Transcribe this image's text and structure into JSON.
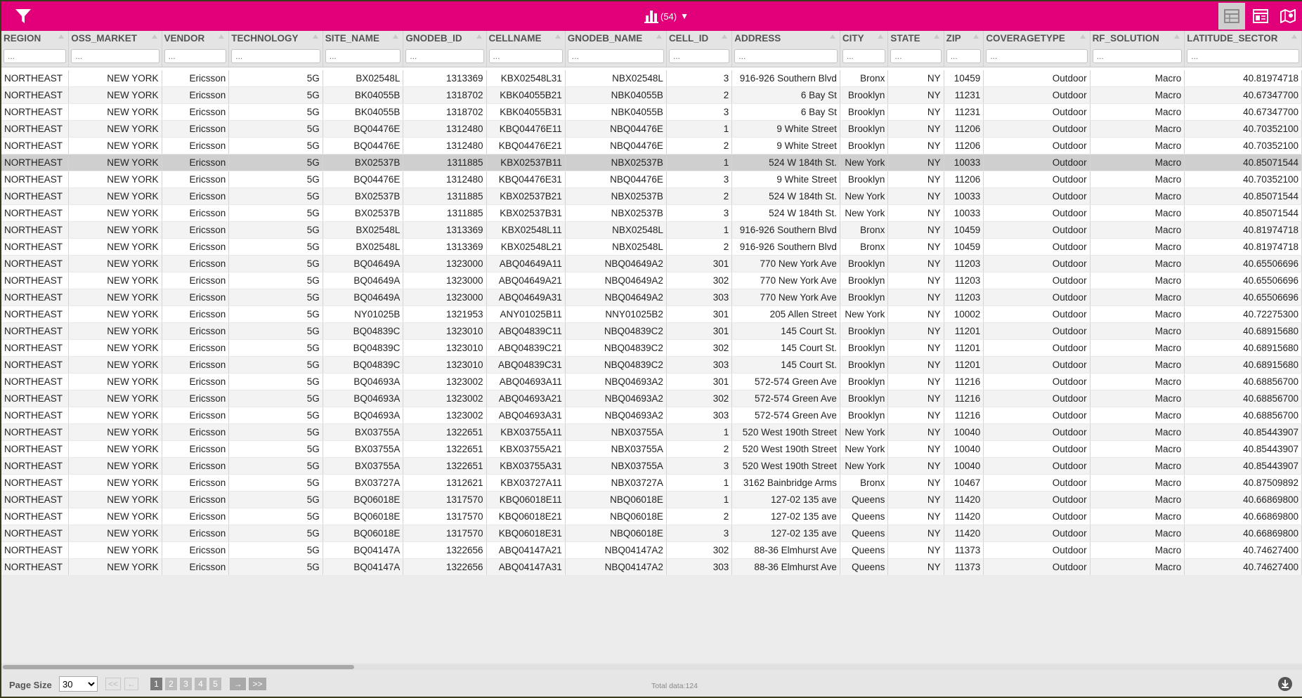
{
  "toolbar": {
    "chart_count": "(54)",
    "chart_caret": "▼",
    "colors": {
      "brand": "#e2007a",
      "active_view": "#cfcfcf"
    },
    "icons": [
      "filter-icon",
      "bar-chart-icon",
      "grid-view-icon",
      "report-view-icon",
      "map-view-icon"
    ]
  },
  "columns": [
    {
      "label": "REGION"
    },
    {
      "label": "OSS_MARKET"
    },
    {
      "label": "VENDOR"
    },
    {
      "label": "TECHNOLOGY"
    },
    {
      "label": "SITE_NAME"
    },
    {
      "label": "GNODEB_ID"
    },
    {
      "label": "CELLNAME"
    },
    {
      "label": "GNODEB_NAME"
    },
    {
      "label": "CELL_ID"
    },
    {
      "label": "ADDRESS"
    },
    {
      "label": "CITY"
    },
    {
      "label": "STATE"
    },
    {
      "label": "ZIP"
    },
    {
      "label": "COVERAGETYPE"
    },
    {
      "label": "RF_SOLUTION"
    },
    {
      "label": "LATITUDE_SECTOR"
    }
  ],
  "filter_placeholder": "...",
  "selected_row": 5,
  "rows": [
    [
      "NORTHEAST",
      "NEW YORK",
      "Ericsson",
      "5G",
      "BX02548L",
      "1313369",
      "KBX02548L31",
      "NBX02548L",
      "3",
      "916-926 Southern Blvd",
      "Bronx",
      "NY",
      "10459",
      "Outdoor",
      "Macro",
      "40.81974718"
    ],
    [
      "NORTHEAST",
      "NEW YORK",
      "Ericsson",
      "5G",
      "BK04055B",
      "1318702",
      "KBK04055B21",
      "NBK04055B",
      "2",
      "6 Bay St",
      "Brooklyn",
      "NY",
      "11231",
      "Outdoor",
      "Macro",
      "40.67347700"
    ],
    [
      "NORTHEAST",
      "NEW YORK",
      "Ericsson",
      "5G",
      "BK04055B",
      "1318702",
      "KBK04055B31",
      "NBK04055B",
      "3",
      "6 Bay St",
      "Brooklyn",
      "NY",
      "11231",
      "Outdoor",
      "Macro",
      "40.67347700"
    ],
    [
      "NORTHEAST",
      "NEW YORK",
      "Ericsson",
      "5G",
      "BQ04476E",
      "1312480",
      "KBQ04476E11",
      "NBQ04476E",
      "1",
      "9 White Street",
      "Brooklyn",
      "NY",
      "11206",
      "Outdoor",
      "Macro",
      "40.70352100"
    ],
    [
      "NORTHEAST",
      "NEW YORK",
      "Ericsson",
      "5G",
      "BQ04476E",
      "1312480",
      "KBQ04476E21",
      "NBQ04476E",
      "2",
      "9 White Street",
      "Brooklyn",
      "NY",
      "11206",
      "Outdoor",
      "Macro",
      "40.70352100"
    ],
    [
      "NORTHEAST",
      "NEW YORK",
      "Ericsson",
      "5G",
      "BX02537B",
      "1311885",
      "KBX02537B11",
      "NBX02537B",
      "1",
      "524 W 184th St.",
      "New York",
      "NY",
      "10033",
      "Outdoor",
      "Macro",
      "40.85071544"
    ],
    [
      "NORTHEAST",
      "NEW YORK",
      "Ericsson",
      "5G",
      "BQ04476E",
      "1312480",
      "KBQ04476E31",
      "NBQ04476E",
      "3",
      "9 White Street",
      "Brooklyn",
      "NY",
      "11206",
      "Outdoor",
      "Macro",
      "40.70352100"
    ],
    [
      "NORTHEAST",
      "NEW YORK",
      "Ericsson",
      "5G",
      "BX02537B",
      "1311885",
      "KBX02537B21",
      "NBX02537B",
      "2",
      "524 W 184th St.",
      "New York",
      "NY",
      "10033",
      "Outdoor",
      "Macro",
      "40.85071544"
    ],
    [
      "NORTHEAST",
      "NEW YORK",
      "Ericsson",
      "5G",
      "BX02537B",
      "1311885",
      "KBX02537B31",
      "NBX02537B",
      "3",
      "524 W 184th St.",
      "New York",
      "NY",
      "10033",
      "Outdoor",
      "Macro",
      "40.85071544"
    ],
    [
      "NORTHEAST",
      "NEW YORK",
      "Ericsson",
      "5G",
      "BX02548L",
      "1313369",
      "KBX02548L11",
      "NBX02548L",
      "1",
      "916-926 Southern Blvd",
      "Bronx",
      "NY",
      "10459",
      "Outdoor",
      "Macro",
      "40.81974718"
    ],
    [
      "NORTHEAST",
      "NEW YORK",
      "Ericsson",
      "5G",
      "BX02548L",
      "1313369",
      "KBX02548L21",
      "NBX02548L",
      "2",
      "916-926 Southern Blvd",
      "Bronx",
      "NY",
      "10459",
      "Outdoor",
      "Macro",
      "40.81974718"
    ],
    [
      "NORTHEAST",
      "NEW YORK",
      "Ericsson",
      "5G",
      "BQ04649A",
      "1323000",
      "ABQ04649A11",
      "NBQ04649A2",
      "301",
      "770 New York Ave",
      "Brooklyn",
      "NY",
      "11203",
      "Outdoor",
      "Macro",
      "40.65506696"
    ],
    [
      "NORTHEAST",
      "NEW YORK",
      "Ericsson",
      "5G",
      "BQ04649A",
      "1323000",
      "ABQ04649A21",
      "NBQ04649A2",
      "302",
      "770 New York Ave",
      "Brooklyn",
      "NY",
      "11203",
      "Outdoor",
      "Macro",
      "40.65506696"
    ],
    [
      "NORTHEAST",
      "NEW YORK",
      "Ericsson",
      "5G",
      "BQ04649A",
      "1323000",
      "ABQ04649A31",
      "NBQ04649A2",
      "303",
      "770 New York Ave",
      "Brooklyn",
      "NY",
      "11203",
      "Outdoor",
      "Macro",
      "40.65506696"
    ],
    [
      "NORTHEAST",
      "NEW YORK",
      "Ericsson",
      "5G",
      "NY01025B",
      "1321953",
      "ANY01025B11",
      "NNY01025B2",
      "301",
      "205 Allen Street",
      "New York",
      "NY",
      "10002",
      "Outdoor",
      "Macro",
      "40.72275300"
    ],
    [
      "NORTHEAST",
      "NEW YORK",
      "Ericsson",
      "5G",
      "BQ04839C",
      "1323010",
      "ABQ04839C11",
      "NBQ04839C2",
      "301",
      "145 Court St.",
      "Brooklyn",
      "NY",
      "11201",
      "Outdoor",
      "Macro",
      "40.68915680"
    ],
    [
      "NORTHEAST",
      "NEW YORK",
      "Ericsson",
      "5G",
      "BQ04839C",
      "1323010",
      "ABQ04839C21",
      "NBQ04839C2",
      "302",
      "145 Court St.",
      "Brooklyn",
      "NY",
      "11201",
      "Outdoor",
      "Macro",
      "40.68915680"
    ],
    [
      "NORTHEAST",
      "NEW YORK",
      "Ericsson",
      "5G",
      "BQ04839C",
      "1323010",
      "ABQ04839C31",
      "NBQ04839C2",
      "303",
      "145 Court St.",
      "Brooklyn",
      "NY",
      "11201",
      "Outdoor",
      "Macro",
      "40.68915680"
    ],
    [
      "NORTHEAST",
      "NEW YORK",
      "Ericsson",
      "5G",
      "BQ04693A",
      "1323002",
      "ABQ04693A11",
      "NBQ04693A2",
      "301",
      "572-574 Green Ave",
      "Brooklyn",
      "NY",
      "11216",
      "Outdoor",
      "Macro",
      "40.68856700"
    ],
    [
      "NORTHEAST",
      "NEW YORK",
      "Ericsson",
      "5G",
      "BQ04693A",
      "1323002",
      "ABQ04693A21",
      "NBQ04693A2",
      "302",
      "572-574 Green Ave",
      "Brooklyn",
      "NY",
      "11216",
      "Outdoor",
      "Macro",
      "40.68856700"
    ],
    [
      "NORTHEAST",
      "NEW YORK",
      "Ericsson",
      "5G",
      "BQ04693A",
      "1323002",
      "ABQ04693A31",
      "NBQ04693A2",
      "303",
      "572-574 Green Ave",
      "Brooklyn",
      "NY",
      "11216",
      "Outdoor",
      "Macro",
      "40.68856700"
    ],
    [
      "NORTHEAST",
      "NEW YORK",
      "Ericsson",
      "5G",
      "BX03755A",
      "1322651",
      "KBX03755A11",
      "NBX03755A",
      "1",
      "520 West 190th Street",
      "New York",
      "NY",
      "10040",
      "Outdoor",
      "Macro",
      "40.85443907"
    ],
    [
      "NORTHEAST",
      "NEW YORK",
      "Ericsson",
      "5G",
      "BX03755A",
      "1322651",
      "KBX03755A21",
      "NBX03755A",
      "2",
      "520 West 190th Street",
      "New York",
      "NY",
      "10040",
      "Outdoor",
      "Macro",
      "40.85443907"
    ],
    [
      "NORTHEAST",
      "NEW YORK",
      "Ericsson",
      "5G",
      "BX03755A",
      "1322651",
      "KBX03755A31",
      "NBX03755A",
      "3",
      "520 West 190th Street",
      "New York",
      "NY",
      "10040",
      "Outdoor",
      "Macro",
      "40.85443907"
    ],
    [
      "NORTHEAST",
      "NEW YORK",
      "Ericsson",
      "5G",
      "BX03727A",
      "1312621",
      "KBX03727A11",
      "NBX03727A",
      "1",
      "3162 Bainbridge Arms",
      "Bronx",
      "NY",
      "10467",
      "Outdoor",
      "Macro",
      "40.87509892"
    ],
    [
      "NORTHEAST",
      "NEW YORK",
      "Ericsson",
      "5G",
      "BQ06018E",
      "1317570",
      "KBQ06018E11",
      "NBQ06018E",
      "1",
      "127-02 135 ave",
      "Queens",
      "NY",
      "11420",
      "Outdoor",
      "Macro",
      "40.66869800"
    ],
    [
      "NORTHEAST",
      "NEW YORK",
      "Ericsson",
      "5G",
      "BQ06018E",
      "1317570",
      "KBQ06018E21",
      "NBQ06018E",
      "2",
      "127-02 135 ave",
      "Queens",
      "NY",
      "11420",
      "Outdoor",
      "Macro",
      "40.66869800"
    ],
    [
      "NORTHEAST",
      "NEW YORK",
      "Ericsson",
      "5G",
      "BQ06018E",
      "1317570",
      "KBQ06018E31",
      "NBQ06018E",
      "3",
      "127-02 135 ave",
      "Queens",
      "NY",
      "11420",
      "Outdoor",
      "Macro",
      "40.66869800"
    ],
    [
      "NORTHEAST",
      "NEW YORK",
      "Ericsson",
      "5G",
      "BQ04147A",
      "1322656",
      "ABQ04147A21",
      "NBQ04147A2",
      "302",
      "88-36 Elmhurst Ave",
      "Queens",
      "NY",
      "11373",
      "Outdoor",
      "Macro",
      "40.74627400"
    ],
    [
      "NORTHEAST",
      "NEW YORK",
      "Ericsson",
      "5G",
      "BQ04147A",
      "1322656",
      "ABQ04147A31",
      "NBQ04147A2",
      "303",
      "88-36 Elmhurst Ave",
      "Queens",
      "NY",
      "11373",
      "Outdoor",
      "Macro",
      "40.74627400"
    ]
  ],
  "pager": {
    "page_size_label": "Page Size",
    "page_size_value": "30",
    "first": "<<",
    "prev": "←",
    "next": "→",
    "last": ">>",
    "pages": [
      "1",
      "2",
      "3",
      "4",
      "5"
    ],
    "active_page": "1",
    "total": "Total data:124"
  },
  "horizontal_scroll_fraction": 0.27
}
